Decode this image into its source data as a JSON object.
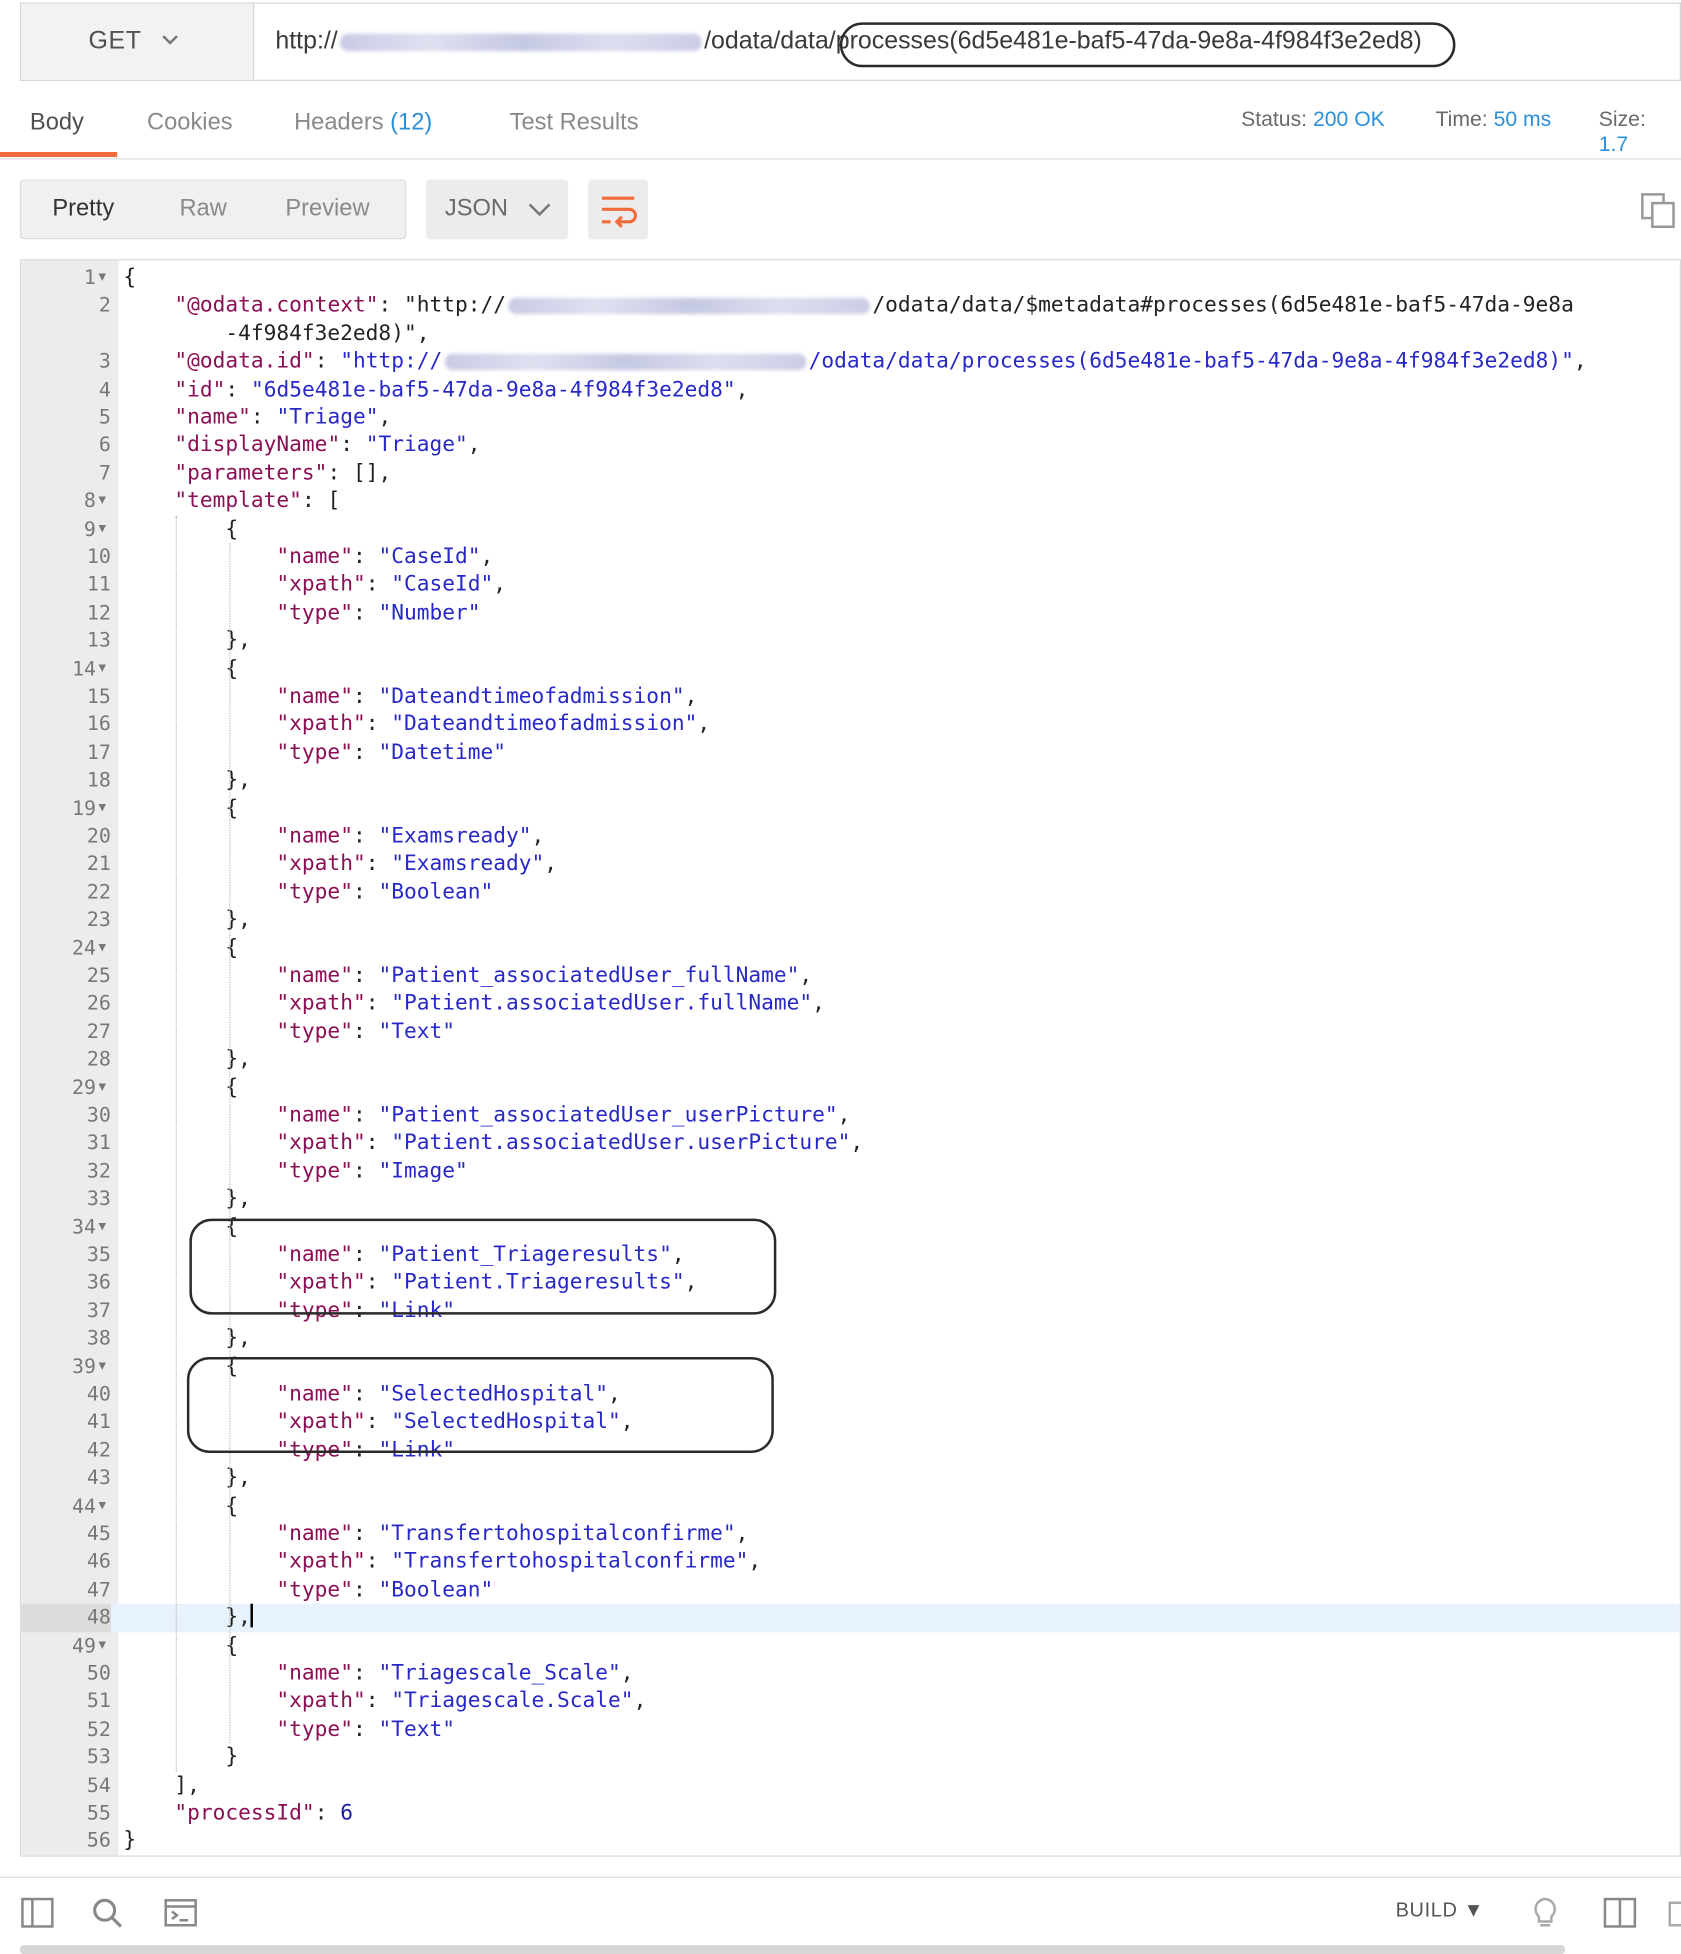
{
  "request": {
    "method": "GET",
    "url_prefix": "http://",
    "url_mid": "/odata/data",
    "url_suffix": "/processes(6d5e481e-baf5-47da-9e8a-4f984f3e2ed8)"
  },
  "tabs": {
    "body": "Body",
    "cookies": "Cookies",
    "headers": "Headers",
    "headers_count": "(12)",
    "tests": "Test Results"
  },
  "status": {
    "status_label": "Status:",
    "status_value": "200 OK",
    "time_label": "Time:",
    "time_value": "50 ms",
    "size_label": "Size:",
    "size_value": "1.7"
  },
  "view": {
    "pretty": "Pretty",
    "raw": "Raw",
    "preview": "Preview",
    "format": "JSON"
  },
  "editor": {
    "highlighted_line": 48,
    "lines": [
      "{",
      "    \"@odata.context\": \"http://{BLUR}/odata/data/$metadata#processes(6d5e481e-baf5-47da-9e8a",
      "        -4f984f3e2ed8)\",",
      "    \"@odata.id\": \"http://{BLUR}/odata/data/processes(6d5e481e-baf5-47da-9e8a-4f984f3e2ed8)\",",
      "    \"id\": \"6d5e481e-baf5-47da-9e8a-4f984f3e2ed8\",",
      "    \"name\": \"Triage\",",
      "    \"displayName\": \"Triage\",",
      "    \"parameters\": [],",
      "    \"template\": [",
      "        {",
      "            \"name\": \"CaseId\",",
      "            \"xpath\": \"CaseId\",",
      "            \"type\": \"Number\"",
      "        },",
      "        {",
      "            \"name\": \"Dateandtimeofadmission\",",
      "            \"xpath\": \"Dateandtimeofadmission\",",
      "            \"type\": \"Datetime\"",
      "        },",
      "        {",
      "            \"name\": \"Examsready\",",
      "            \"xpath\": \"Examsready\",",
      "            \"type\": \"Boolean\"",
      "        },",
      "        {",
      "            \"name\": \"Patient_associatedUser_fullName\",",
      "            \"xpath\": \"Patient.associatedUser.fullName\",",
      "            \"type\": \"Text\"",
      "        },",
      "        {",
      "            \"name\": \"Patient_associatedUser_userPicture\",",
      "            \"xpath\": \"Patient.associatedUser.userPicture\",",
      "            \"type\": \"Image\"",
      "        },",
      "        {",
      "            \"name\": \"Patient_Triageresults\",",
      "            \"xpath\": \"Patient.Triageresults\",",
      "            \"type\": \"Link\"",
      "        },",
      "        {",
      "            \"name\": \"SelectedHospital\",",
      "            \"xpath\": \"SelectedHospital\",",
      "            \"type\": \"Link\"",
      "        },",
      "        {",
      "            \"name\": \"Transfertohospitalconfirme\",",
      "            \"xpath\": \"Transfertohospitalconfirme\",",
      "            \"type\": \"Boolean\"",
      "        },",
      "        {",
      "            \"name\": \"Triagescale_Scale\",",
      "            \"xpath\": \"Triagescale.Scale\",",
      "            \"type\": \"Text\"",
      "        }",
      "    ],",
      "    \"processId\": 6",
      "}"
    ],
    "line_numbers": [
      "1",
      "2",
      "",
      "3",
      "4",
      "5",
      "6",
      "7",
      "8",
      "9",
      "10",
      "11",
      "12",
      "13",
      "14",
      "15",
      "16",
      "17",
      "18",
      "19",
      "20",
      "21",
      "22",
      "23",
      "24",
      "25",
      "26",
      "27",
      "28",
      "29",
      "30",
      "31",
      "32",
      "33",
      "34",
      "35",
      "36",
      "37",
      "38",
      "39",
      "40",
      "41",
      "42",
      "43",
      "44",
      "45",
      "46",
      "47",
      "48",
      "49",
      "50",
      "51",
      "52",
      "53",
      "54",
      "55",
      "56"
    ],
    "foldable": [
      1,
      8,
      9,
      14,
      19,
      24,
      29,
      34,
      39,
      44,
      49
    ]
  },
  "footer": {
    "build": "BUILD"
  },
  "colors": {
    "accent": "#f26b3a",
    "link_blue": "#2b8fd8",
    "key": "#8b0f55",
    "string": "#2828c8"
  }
}
